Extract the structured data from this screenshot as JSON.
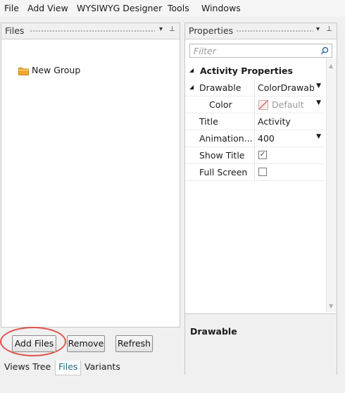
{
  "menu": [
    "File",
    "Add View",
    "WYSIWYG Designer",
    "Tools",
    "Windows"
  ],
  "files_panel": {
    "title": "Files",
    "tree": [
      {
        "label": "New Group",
        "icon": "folder-icon"
      }
    ],
    "buttons": {
      "add": "Add Files",
      "remove": "Remove",
      "refresh": "Refresh"
    }
  },
  "bottom_tabs": [
    {
      "label": "Views Tree",
      "active": false
    },
    {
      "label": "Files",
      "active": true
    },
    {
      "label": "Variants",
      "active": false
    }
  ],
  "properties_panel": {
    "title": "Properties",
    "filter_placeholder": "Filter",
    "category": "Activity Properties",
    "rows": [
      {
        "name": "Drawable",
        "value": "ColorDrawab",
        "kind": "dropdown"
      },
      {
        "name": "Color",
        "value": "Default",
        "kind": "color-dropdown"
      },
      {
        "name": "Title",
        "value": "Activity",
        "kind": "text"
      },
      {
        "name": "Animation...",
        "value": "400",
        "kind": "dropdown"
      },
      {
        "name": "Show Title",
        "value": "checked",
        "kind": "checkbox"
      },
      {
        "name": "Full Screen",
        "value": "unchecked",
        "kind": "checkbox"
      }
    ],
    "description_title": "Drawable"
  },
  "colors": {
    "accent": "#1a6d86",
    "highlight": "#e0534d",
    "folder": "#f0a830"
  }
}
